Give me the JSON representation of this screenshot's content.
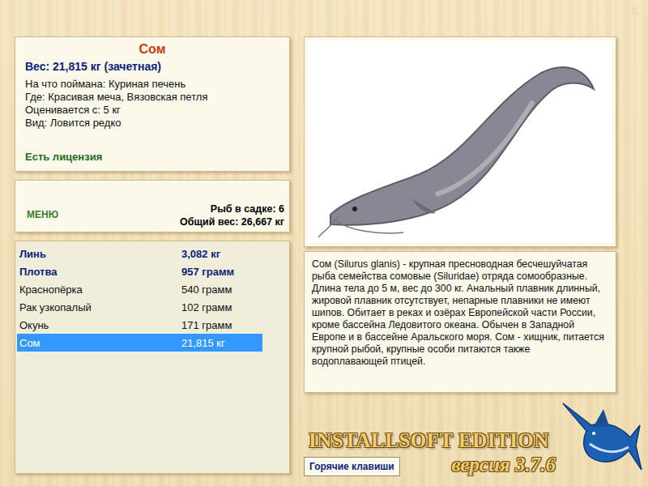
{
  "window": {
    "close": "×"
  },
  "fish_card": {
    "title": "Сом",
    "weight": "Вес: 21,815 кг (зачетная)",
    "details": [
      "На что поймана: Куриная печень",
      "Где: Красивая меча, Вязовская петля",
      "Оценивается с: 5 кг",
      "Вид: Ловится редко"
    ],
    "license": "Есть лицензия"
  },
  "menu_panel": {
    "menu": "МЕНЮ",
    "fish_count": "Рыб в садке: 6",
    "total_weight": "Общий вес: 26,667 кг"
  },
  "catch_list": [
    {
      "name": "Линь",
      "weight": "3,082 кг",
      "trophy": true,
      "selected": false
    },
    {
      "name": "Плотва",
      "weight": "957 грамм",
      "trophy": true,
      "selected": false
    },
    {
      "name": "Краснопёрка",
      "weight": "540 грамм",
      "trophy": false,
      "selected": false
    },
    {
      "name": "Рак узкопалый",
      "weight": "102 грамм",
      "trophy": false,
      "selected": false
    },
    {
      "name": "Окунь",
      "weight": "171 грамм",
      "trophy": false,
      "selected": false
    },
    {
      "name": "Сом",
      "weight": "21,815 кг",
      "trophy": true,
      "selected": true
    }
  ],
  "description": "Сом (Silurus glanis) - крупная пресноводная бесчешуйчатая рыба семейства сомовые (Siluridae) отряда сомообразные. Длина тела до 5 м, вес до 300 кг. Анальный плавник длинный, жировой плавник отсутствует, непарные плавники не имеют шипов. Обитает в реках и озёрах Европейской части России, кроме бассейна Ледовитого океана. Обычен в Западной Европе и в бассейне Аральского моря. Сом - хищник, питается крупной рыбой, крупные особи питаются также водоплавающей птицей.",
  "logo": {
    "title": "INSTALLSOFT EDITION",
    "version": "версия 3.7.6"
  },
  "buttons": [
    "Горячие клавиши"
  ]
}
